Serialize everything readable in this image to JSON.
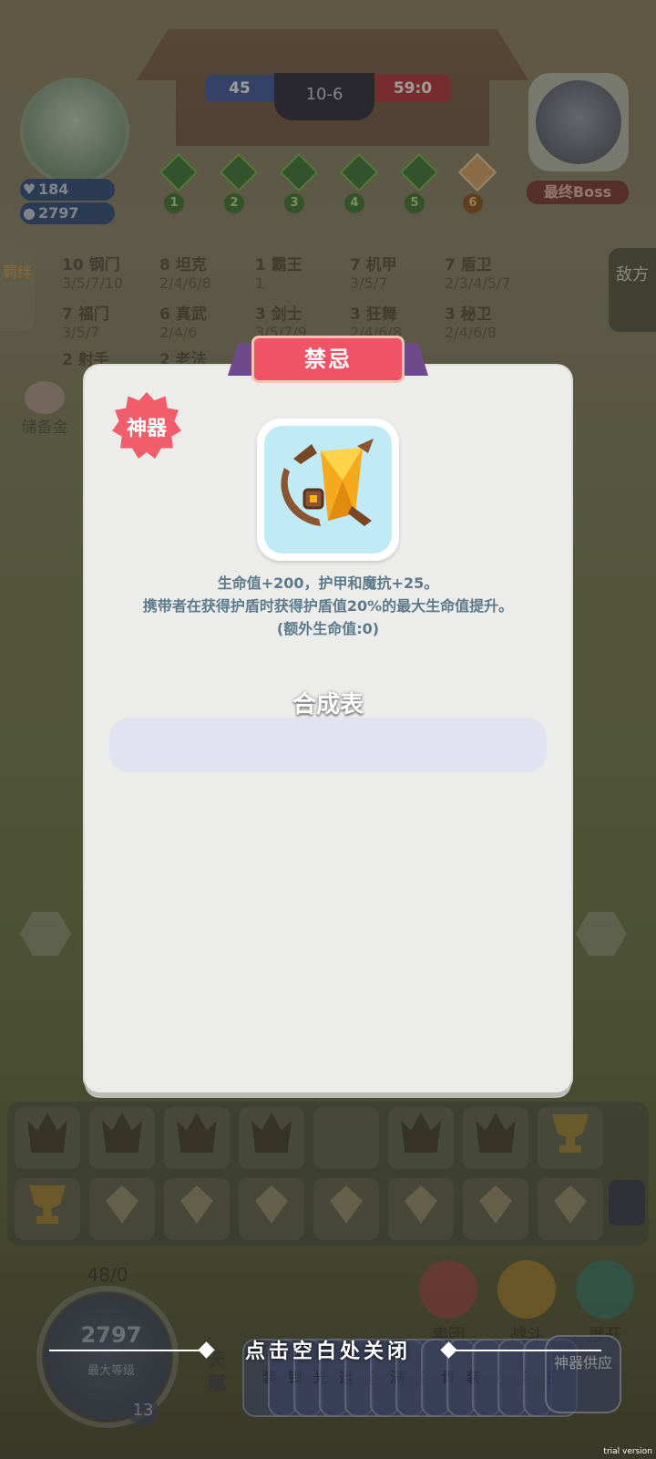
{
  "hud": {
    "score_left": "45",
    "score_mid": "10-6",
    "score_right": "59:0",
    "hp": "184",
    "gold_top": "2797",
    "boss_label": "最终Boss",
    "stages": [
      "1",
      "2",
      "3",
      "4",
      "5",
      "6"
    ]
  },
  "synergies": [
    {
      "name": "10 钢门",
      "stack": "3/5/7/10"
    },
    {
      "name": "8 坦克",
      "stack": "2/4/6/8"
    },
    {
      "name": "1 霸王",
      "stack": "1"
    },
    {
      "name": "7 机甲",
      "stack": "3/5/7"
    },
    {
      "name": "7 盾卫",
      "stack": "2/3/4/5/7"
    },
    {
      "name": "7 福门",
      "stack": "3/5/7"
    },
    {
      "name": "6 真武",
      "stack": "2/4/6"
    },
    {
      "name": "3 剑士",
      "stack": "3/5/7/9"
    },
    {
      "name": "3 狂舞",
      "stack": "2/4/6/8"
    },
    {
      "name": "3 秘卫",
      "stack": "2/4/6/8"
    },
    {
      "name": "2 射手",
      "stack": ""
    },
    {
      "name": "2 老法",
      "stack": ""
    }
  ],
  "side": {
    "left_tab": "羁绊",
    "right_tab": "敌方",
    "reserve": "储备金"
  },
  "dialog": {
    "title": "禁忌",
    "badge": "神器",
    "desc_line1": "生命值+200，护甲和魔抗+25。",
    "desc_line2": "携带者在获得护盾时获得护盾值20%的最大生命值提升。",
    "desc_line3": "(额外生命值:0)",
    "recipe_title": "合成表"
  },
  "close_hint": "点击空白处关闭",
  "bottom": {
    "xp": "48/0",
    "gold": "2797",
    "max_level": "最大等级",
    "level": "13",
    "sell": "卖闭",
    "fight": "战斗",
    "expand": "展开",
    "talent": "天赋",
    "cards": [
      "装",
      "锁",
      "光",
      "运",
      "[",
      "满",
      "[",
      "青",
      "装",
      "[",
      "[",
      "["
    ],
    "supply": "神器供应"
  },
  "inventory": {
    "row1": [
      "crown",
      "crown",
      "crown",
      "crown",
      "empty",
      "crown",
      "crown",
      "cup"
    ],
    "row2": [
      "cup",
      "gem",
      "gem",
      "gem",
      "gem",
      "gem",
      "gem",
      "gem"
    ]
  },
  "watermark": "trial version"
}
